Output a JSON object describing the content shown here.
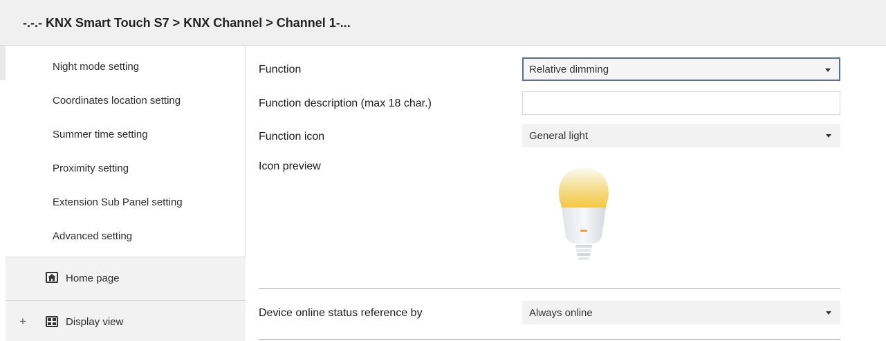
{
  "header": {
    "breadcrumb": "-.-.- KNX Smart Touch S7 > KNX Channel  > Channel 1-..."
  },
  "sidebar": {
    "items": [
      {
        "label": "Night mode setting"
      },
      {
        "label": "Coordinates location setting"
      },
      {
        "label": "Summer time setting"
      },
      {
        "label": "Proximity setting"
      },
      {
        "label": "Extension Sub Panel setting"
      },
      {
        "label": "Advanced setting"
      }
    ],
    "home": {
      "label": "Home page",
      "icon": "home-icon"
    },
    "display": {
      "label": "Display view",
      "icon": "grid-icon",
      "expand": "+"
    }
  },
  "params": {
    "function": {
      "label": "Function",
      "value": "Relative dimming"
    },
    "description": {
      "label": "Function description (max 18 char.)",
      "value": ""
    },
    "icon": {
      "label": "Function icon",
      "value": "General light"
    },
    "preview": {
      "label": "Icon preview"
    },
    "online": {
      "label": "Device online status reference by",
      "value": "Always online"
    }
  },
  "colors": {
    "active_border": "#5b6f8c",
    "field_bg": "#f2f2f2",
    "bulb_glow": "#f5c842"
  }
}
